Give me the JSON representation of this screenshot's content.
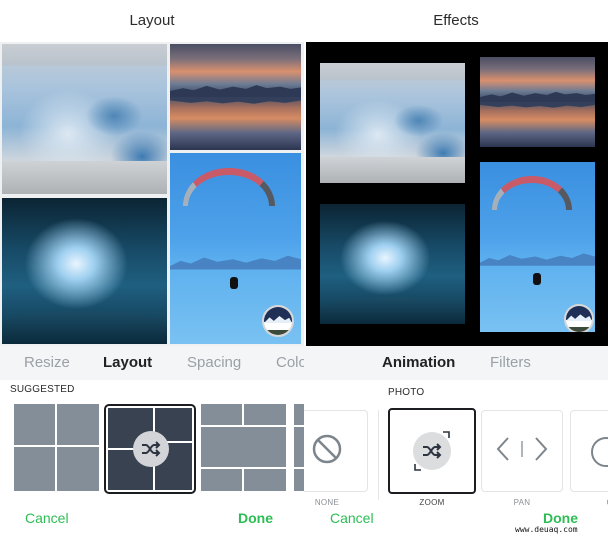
{
  "left_panel": {
    "title": "Layout",
    "photos": [
      "glacier",
      "sunset-lake-reflection",
      "ice-cave",
      "paraglider"
    ],
    "tabs": [
      {
        "label": "Resize",
        "active": false
      },
      {
        "label": "Layout",
        "active": true
      },
      {
        "label": "Spacing",
        "active": false
      },
      {
        "label": "Colo",
        "active": false
      }
    ],
    "section_label": "SUGGESTED",
    "layouts": [
      {
        "name": "grid-2x2",
        "selected": false
      },
      {
        "name": "staggered-2x2-shuffle",
        "selected": true,
        "icon": "shuffle-icon"
      },
      {
        "name": "rows-2-1-2",
        "selected": false
      },
      {
        "name": "column-partial",
        "selected": false
      }
    ],
    "cancel_label": "Cancel",
    "done_label": "Done"
  },
  "right_panel": {
    "title": "Effects",
    "photos": [
      "glacier",
      "sunset-lake-reflection",
      "ice-cave",
      "paraglider"
    ],
    "tabs": [
      {
        "label": "Animation",
        "active": true
      },
      {
        "label": "Filters",
        "active": false
      }
    ],
    "section_label": "PHOTO",
    "animations": [
      {
        "label": "NONE",
        "icon": "prohibited-icon",
        "selected": false
      },
      {
        "label": "ZOOM",
        "icon": "shuffle-zoom-icon",
        "selected": true
      },
      {
        "label": "PAN",
        "icon": "pan-arrows-icon",
        "selected": false
      },
      {
        "label": "GI",
        "icon": "circle-icon",
        "selected": false
      }
    ],
    "cancel_label": "Cancel",
    "done_label": "Done"
  },
  "watermark": "www.deuaq.com",
  "colors": {
    "accent_green": "#2dbd55",
    "selected_border": "#1b1d20",
    "thumb_cell": "#848e98",
    "thumb_cell_selected": "#384250"
  }
}
